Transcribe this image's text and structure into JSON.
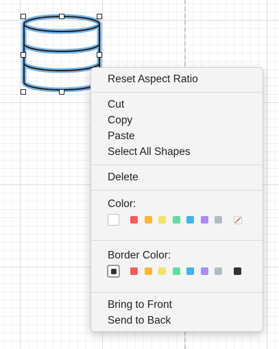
{
  "context_menu": {
    "reset_aspect_ratio": "Reset Aspect Ratio",
    "cut": "Cut",
    "copy": "Copy",
    "paste": "Paste",
    "select_all_shapes": "Select All Shapes",
    "delete": "Delete",
    "color_label": "Color:",
    "border_color_label": "Border Color:",
    "bring_to_front": "Bring to Front",
    "send_to_back": "Send to Back"
  },
  "fill_colors": {
    "selected": "none",
    "swatches": [
      "#ff5a5a",
      "#f8b73a",
      "#f4e26a",
      "#63dca2",
      "#3fb4f0",
      "#a98cf0",
      "#b1bcc2"
    ],
    "clear_icon": "no-color-icon"
  },
  "border_colors": {
    "selected": "#333333",
    "swatches": [
      "#ff5a5a",
      "#f8b73a",
      "#f4e26a",
      "#63dca2",
      "#3fb4f0",
      "#a98cf0",
      "#b1bcc2",
      "#333333"
    ]
  },
  "shape": {
    "icon": "database-cylinder-icon",
    "stroke": "#1f1f1f",
    "highlight": "#7ab4e6"
  },
  "colors": {
    "menu_background": "#f4f4f4",
    "grid": "#dcdcdc"
  }
}
